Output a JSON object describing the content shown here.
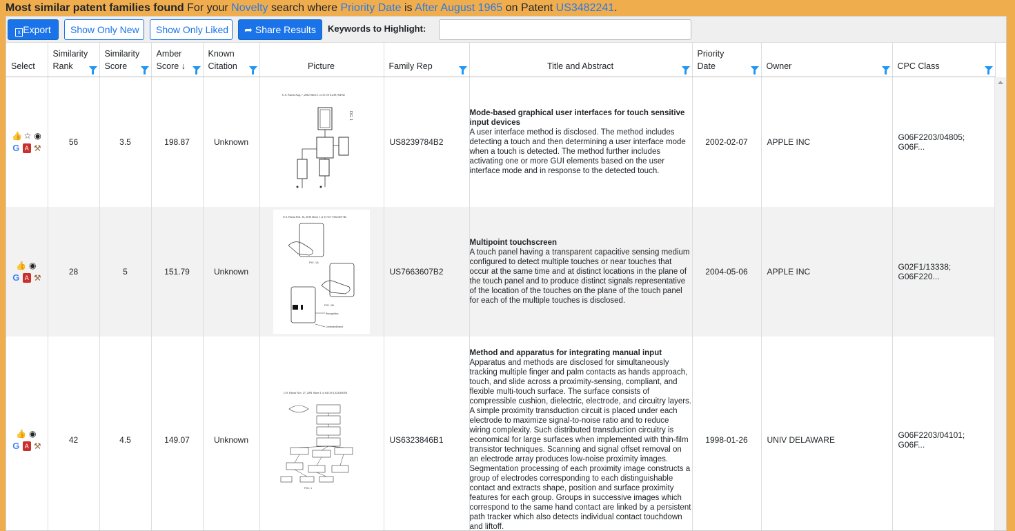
{
  "headline": {
    "bold": "Most similar patent families found",
    "p1": " For your ",
    "search_type": "Novelty",
    "p2": " search where ",
    "field": "Priority Date",
    "p3": " is ",
    "condition": "After August 1965",
    "p4": " on Patent ",
    "patent": "US3482241",
    "p5": "."
  },
  "toolbar": {
    "export_label": "Export",
    "show_new_label": "Show Only New",
    "show_liked_label": "Show Only Liked",
    "share_label": "Share Results",
    "keywords_label": "Keywords to Highlight:",
    "keywords_value": ""
  },
  "columns": {
    "select": "Select",
    "sim_rank_1": "Similarity",
    "sim_rank_2": "Rank",
    "sim_score_1": "Similarity",
    "sim_score_2": "Score",
    "amber_1": "Amber",
    "amber_2": "Score ↓",
    "known_1": "Known",
    "known_2": "Citation",
    "picture": "Picture",
    "family_rep": "Family Rep",
    "title_abstract": "Title and Abstract",
    "priority_1": "Priority",
    "priority_2": "Date",
    "owner": "Owner",
    "cpc": "CPC Class"
  },
  "rows": [
    {
      "rank": "56",
      "score": "3.5",
      "amber": "198.87",
      "citation": "Unknown",
      "family_rep": "US8239784B2",
      "title": "Mode-based graphical user interfaces for touch sensitive input devices",
      "abstract": "A user interface method is disclosed. The method includes detecting a touch and then determining a user interface mode when a touch is detected. The method further includes activating one or more GUI elements based on the user interface mode and in response to the detected touch.",
      "priority_date": "2002-02-07",
      "owner": "APPLE INC",
      "cpc": "G06F2203/04805; G06F..."
    },
    {
      "rank": "28",
      "score": "5",
      "amber": "151.79",
      "citation": "Unknown",
      "family_rep": "US7663607B2",
      "title": "Multipoint touchscreen",
      "abstract": "A touch panel having a transparent capacitive sensing medium configured to detect multiple touches or near touches that occur at the same time and at distinct locations in the plane of the touch panel and to produce distinct signals representative of the location of the touches on the plane of the touch panel for each of the multiple touches is disclosed.",
      "priority_date": "2004-05-06",
      "owner": "APPLE INC",
      "cpc": "G02F1/13338; G06F220..."
    },
    {
      "rank": "42",
      "score": "4.5",
      "amber": "149.07",
      "citation": "Unknown",
      "family_rep": "US6323846B1",
      "title": "Method and apparatus for integrating manual input",
      "abstract": "Apparatus and methods are disclosed for simultaneously tracking multiple finger and palm contacts as hands approach, touch, and slide across a proximity-sensing, compliant, and flexible multi-touch surface. The surface consists of compressible cushion, dielectric, electrode, and circuitry layers. A simple proximity transduction circuit is placed under each electrode to maximize signal-to-noise ratio and to reduce wiring complexity. Such distributed transduction circuitry is economical for large surfaces when implemented with thin-film transistor techniques. Scanning and signal offset removal on an electrode array produces low-noise proximity images. Segmentation processing of each proximity image constructs a group of electrodes corresponding to each distinguishable contact and extracts shape, position and surface proximity features for each group. Groups in successive images which correspond to the same hand contact are linked by a persistent path tracker which also detects individual contact touchdown and liftoff.",
      "priority_date": "1998-01-26",
      "owner": "UNIV DELAWARE",
      "cpc": "G06F2203/04101; G06F..."
    }
  ]
}
